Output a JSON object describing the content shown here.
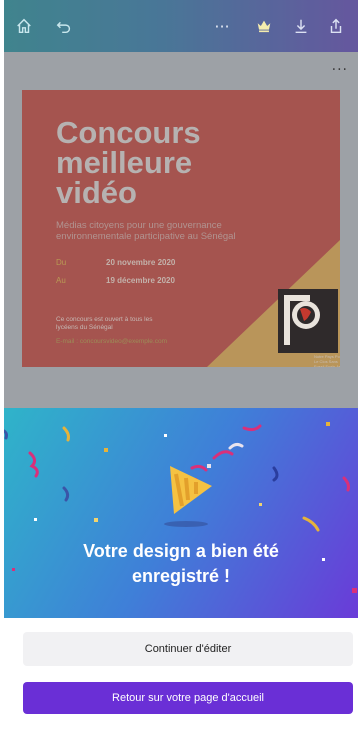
{
  "toolbar": {
    "icons": [
      "home-icon",
      "undo-icon",
      "more-icon",
      "crown-icon",
      "download-icon",
      "share-icon"
    ],
    "more_label": "···"
  },
  "editor": {
    "more_label": "···",
    "card": {
      "title_line1": "Concours",
      "title_line2": "meilleure",
      "title_line3": "vidéo",
      "subtitle": "Médias citoyens pour une gouvernance environnementale participative au Sénégal",
      "row1_key": "Du",
      "row1_value": "20 novembre 2020",
      "row2_key": "Au",
      "row2_value": "19 décembre 2020",
      "note": "Ce concours est ouvert à tous les lycéens du Sénégal",
      "email": "E-mail : concoursvideo@exemple.com",
      "logo_caption": "Notre Pays Pour Le Clos Sans Fossil Fuels Asia",
      "colors": {
        "background": "#a5544f",
        "accent": "#b99a54"
      }
    }
  },
  "success": {
    "title_line1": "Votre design a bien été",
    "title_line2": "enregistré !",
    "icon": "party-popper-icon"
  },
  "actions": {
    "continue_label": "Continuer d'éditer",
    "home_label": "Retour sur votre page d'accueil",
    "primary_color": "#6a2fd6"
  }
}
